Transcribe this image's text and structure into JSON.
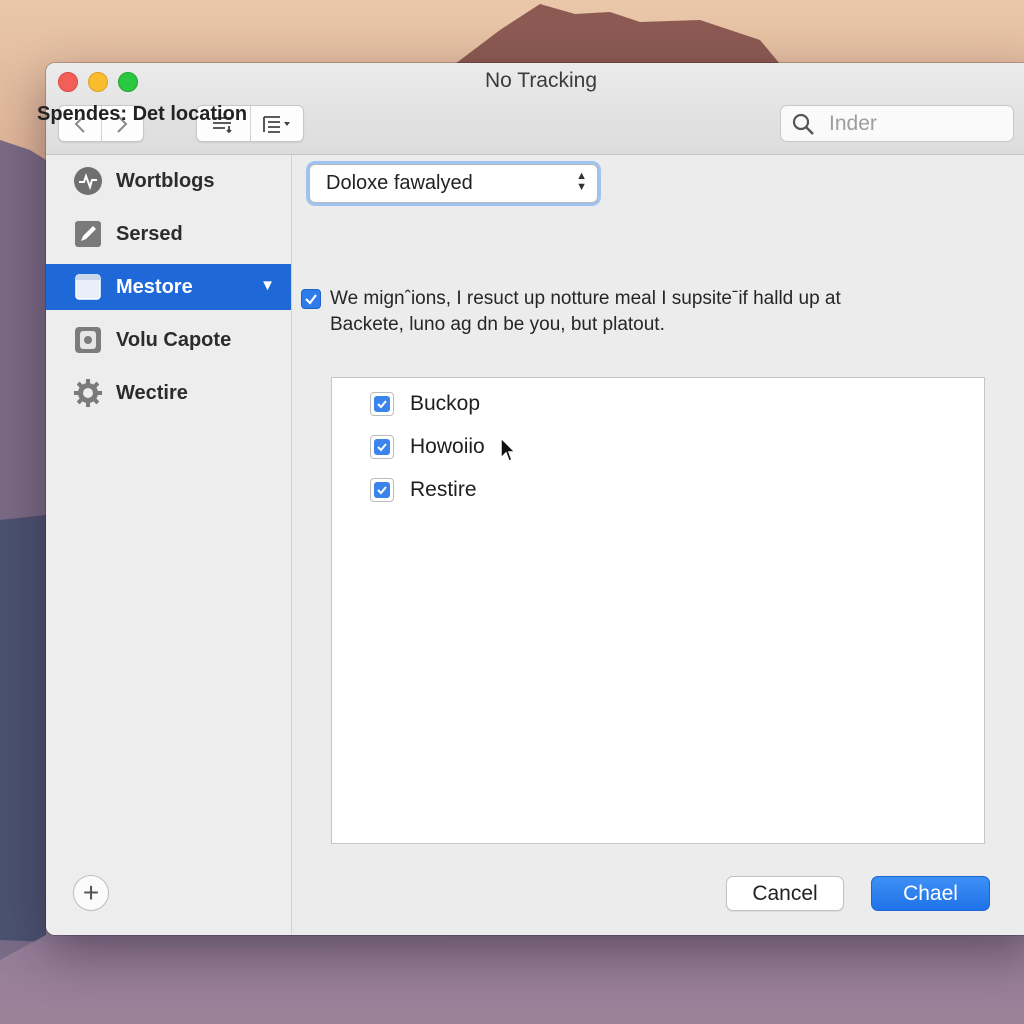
{
  "window": {
    "title": "No Tracking"
  },
  "toolbar": {
    "back_icon": "chevron-left",
    "forward_icon": "chevron-right",
    "view_icon_1": "list-icon",
    "view_icon_2": "outline-menu-icon"
  },
  "search": {
    "placeholder": "Inder"
  },
  "sidebar": {
    "items": [
      {
        "label": "Wortblogs",
        "icon": "activity-icon",
        "active": false
      },
      {
        "label": "Sersed",
        "icon": "edit-icon",
        "active": false
      },
      {
        "label": "Mestore",
        "icon": "window-icon",
        "active": true
      },
      {
        "label": "Volu Capote",
        "icon": "disk-icon",
        "active": false
      },
      {
        "label": "Wectire",
        "icon": "gear-icon",
        "active": false
      }
    ],
    "add_icon": "plus-icon"
  },
  "main": {
    "section_title": "Spendes: Det location",
    "popup_value": "Doloxe fawalyed",
    "description_line1": "We mignˆions, I resuct up notture meal I supsiteˉif halld up at",
    "description_line2": "Backete, luno ag dn be you, but platout.",
    "description_checked": true,
    "list": [
      {
        "label": "Buckop",
        "checked": true
      },
      {
        "label": "Howoiio",
        "checked": true
      },
      {
        "label": "Restire",
        "checked": true
      }
    ]
  },
  "buttons": {
    "cancel": "Cancel",
    "primary": "Chael"
  },
  "colors": {
    "accent": "#1f68d8",
    "primary_button": "#2a7cef",
    "close": "#f25f57",
    "minimize": "#f8bc2e",
    "maximize": "#29c840"
  }
}
